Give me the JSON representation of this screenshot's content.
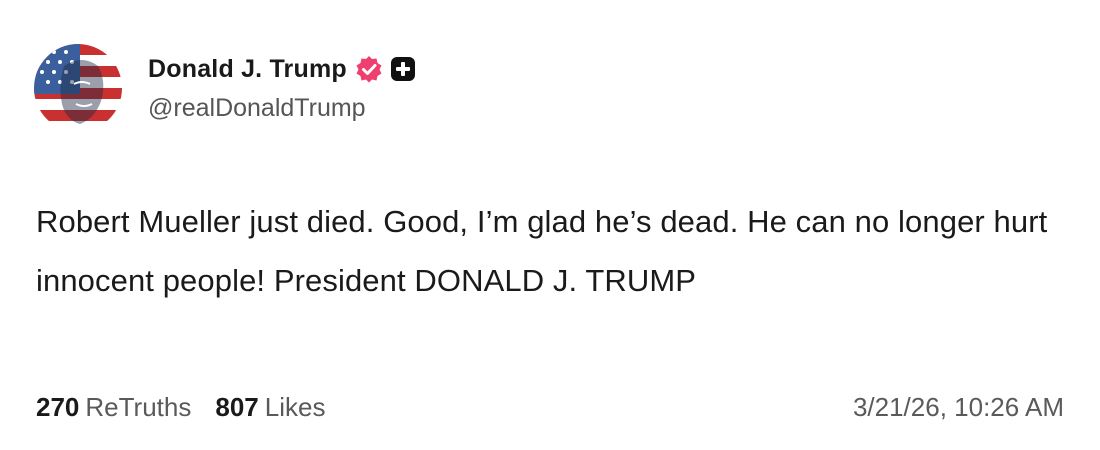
{
  "post": {
    "author": {
      "display_name": "Donald J. Trump",
      "handle": "@realDonaldTrump",
      "verified_color": "#ef3f6e",
      "avatar_icon": "flag-portrait-avatar",
      "extra_icon": "plus-badge-icon"
    },
    "body_text": "Robert Mueller just died. Good, I’m glad he’s dead. He can no longer hurt innocent people! President DONALD J. TRUMP",
    "stats": {
      "retruths_count": "270",
      "retruths_label": "ReTruths",
      "likes_count": "807",
      "likes_label": "Likes"
    },
    "timestamp": "3/21/26, 10:26 AM"
  }
}
